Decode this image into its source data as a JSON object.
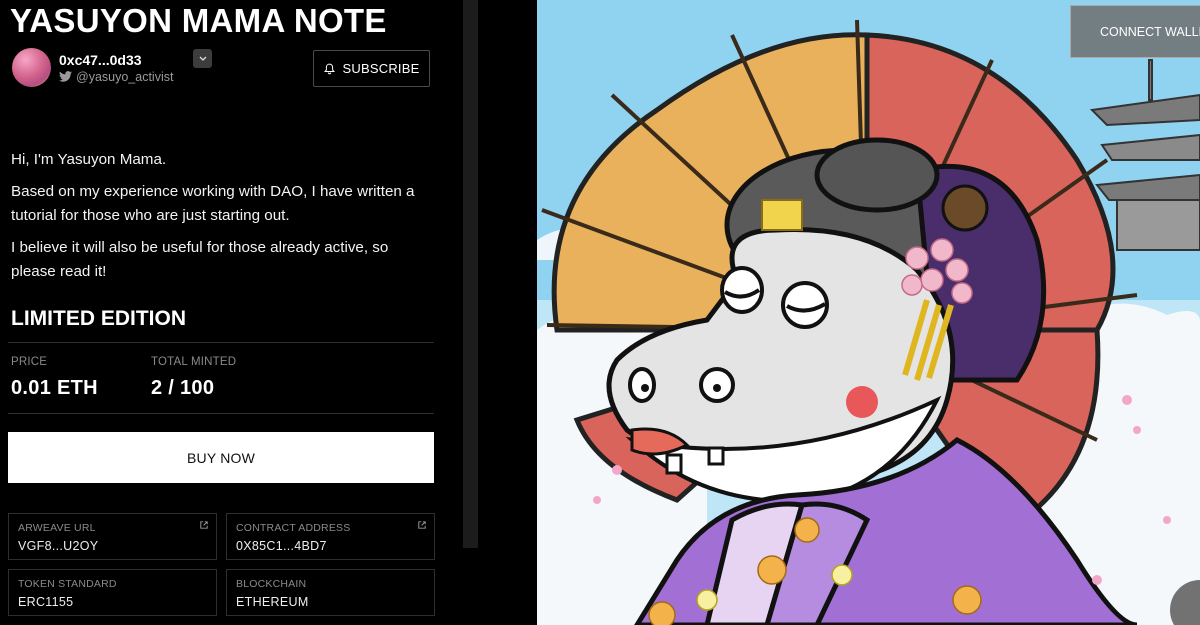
{
  "page": {
    "title": "YASUYON MAMA NOTE",
    "creator": {
      "address": "0xc47...0d33",
      "twitter": "@yasuyo_activist"
    },
    "subscribe_label": "SUBSCRIBE",
    "description": [
      "Hi, I'm Yasuyon Mama.",
      "Based on my experience working with DAO, I have written a tutorial for those who are just starting out.",
      "I believe it will also be useful for those already active, so please read it!"
    ],
    "edition": {
      "title": "LIMITED EDITION",
      "price_label": "PRICE",
      "price_value": "0.01 ETH",
      "minted_label": "TOTAL MINTED",
      "minted_value": "2 / 100"
    },
    "buy_label": "BUY NOW",
    "details": {
      "arweave_label": "ARWEAVE URL",
      "arweave_value": "VGF8...U2OY",
      "contract_label": "CONTRACT ADDRESS",
      "contract_value": "0X85C1...4BD7",
      "token_label": "TOKEN STANDARD",
      "token_value": "ERC1155",
      "chain_label": "BLOCKCHAIN",
      "chain_value": "ETHEREUM"
    },
    "connect_label": "CONNECT WALLET"
  },
  "colors": {
    "background": "#000000",
    "sky": "#8fd3f1",
    "umbrella_orange": "#e9b15c",
    "umbrella_red": "#d9645b",
    "kimono": "#a26fd4"
  },
  "icons": [
    "twitter-icon",
    "bell-icon",
    "chevron-down-icon",
    "external-link-icon"
  ]
}
